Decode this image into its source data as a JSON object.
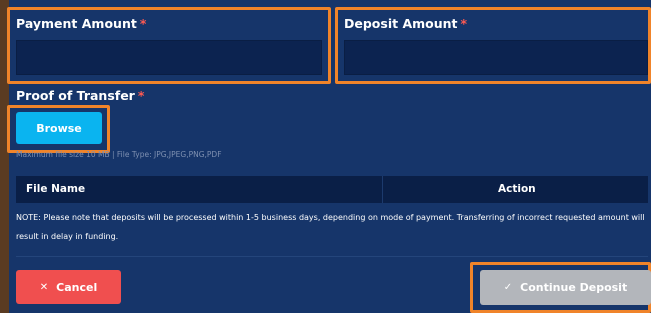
{
  "form": {
    "payment_amount": {
      "label": "Payment Amount",
      "required_mark": "*",
      "value": ""
    },
    "deposit_amount": {
      "label": "Deposit Amount",
      "required_mark": "*",
      "value": ""
    },
    "proof_of_transfer": {
      "label": "Proof of Transfer",
      "required_mark": "*",
      "browse_label": "Browse",
      "hint": "Maximum file size 10 MB | File Type: JPG,JPEG,PNG,PDF"
    }
  },
  "file_table": {
    "columns": [
      "File Name",
      "Action"
    ]
  },
  "note": "NOTE: Please note that deposits will be processed within 1-5 business days, depending on mode of payment. Transferring of incorrect requested amount will result in delay in funding.",
  "actions": {
    "cancel_label": "Cancel",
    "cancel_icon": "close-icon",
    "continue_label": "Continue Deposit",
    "continue_icon": "check-icon"
  },
  "colors": {
    "background": "#16356a",
    "highlight_outline": "#f0842a",
    "browse_button": "#0ab4f0",
    "cancel_button": "#f04f4f",
    "continue_button_disabled": "#b3b6bb",
    "required_mark": "#ff5a52"
  }
}
